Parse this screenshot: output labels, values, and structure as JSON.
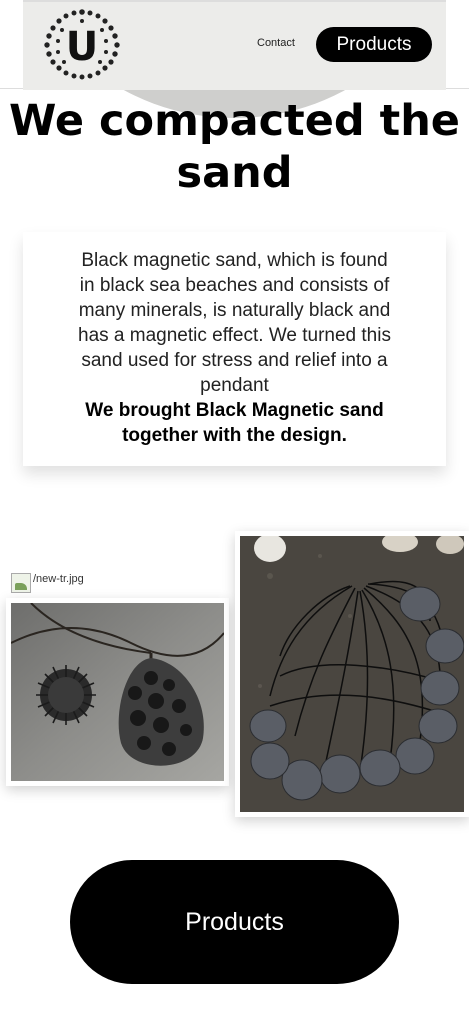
{
  "header": {
    "logo_letter": "U",
    "nav": {
      "contact_label": "Contact",
      "products_label": "Products"
    }
  },
  "hero": {
    "title_line1": "We compacted the",
    "title_line2": "sand"
  },
  "card": {
    "lines": [
      "Black magnetic sand, which is found",
      "in black sea beaches and consists of",
      "many minerals, is naturally black and",
      "has a magnetic effect. We turned this",
      "sand used for stress and relief into a",
      "pendant"
    ],
    "bold_lines": [
      "We brought Black Magnetic sand",
      "together with the design."
    ]
  },
  "gallery": {
    "broken_image_alt": "/new-tr.jpg",
    "photo1_subject": "pendant-and-magnetic-sand-photo",
    "photo2_subject": "stone-pendants-on-sand-photo"
  },
  "cta": {
    "label": "Products"
  },
  "colors": {
    "accent": "#000000",
    "header_band": "#ececea",
    "background": "#ffffff"
  }
}
